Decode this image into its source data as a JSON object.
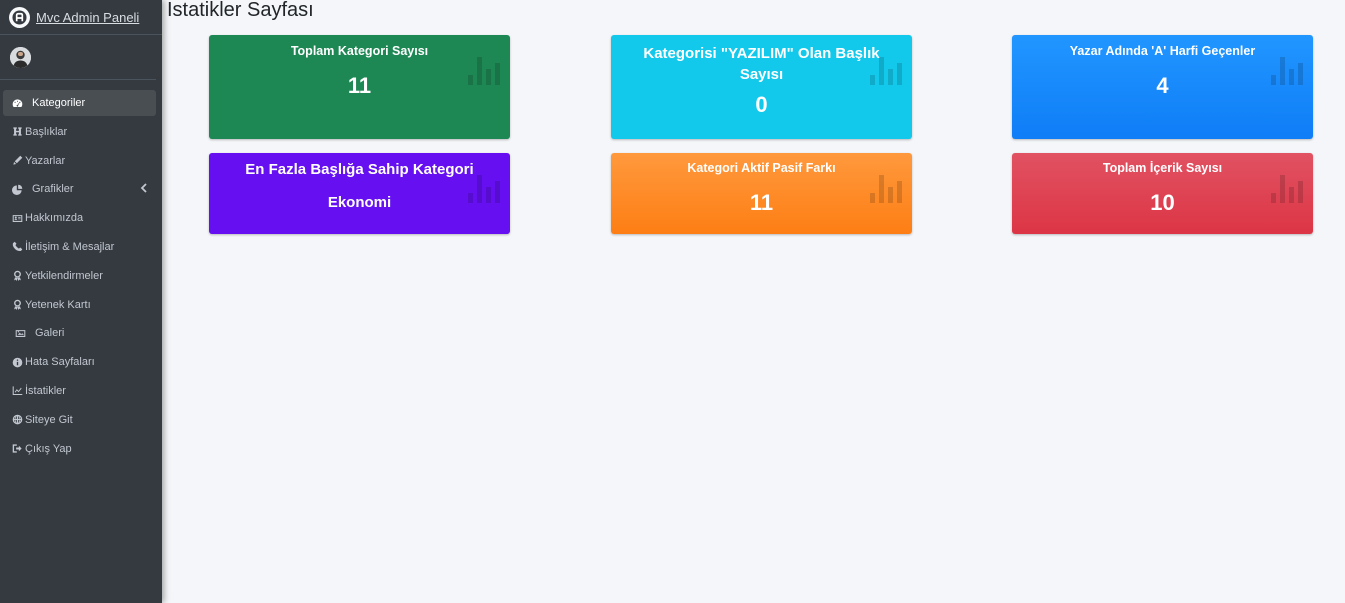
{
  "brand": {
    "name": "Mvc Admin Paneli"
  },
  "page": {
    "title": "İstatikler Sayfası"
  },
  "sidebar": {
    "items": [
      {
        "label": "Kategoriler",
        "icon": "dashboard-icon",
        "active": true
      },
      {
        "label": "Başlıklar",
        "icon": "heading-icon"
      },
      {
        "label": "Yazarlar",
        "icon": "pen-icon"
      },
      {
        "label": "Grafikler",
        "icon": "pie-chart-icon",
        "has_submenu": true
      },
      {
        "label": "Hakkımızda",
        "icon": "id-card-icon"
      },
      {
        "label": "İletişim & Mesajlar",
        "icon": "phone-icon"
      },
      {
        "label": "Yetkilendirmeler",
        "icon": "award-icon"
      },
      {
        "label": "Yetenek Kartı",
        "icon": "award-icon"
      },
      {
        "label": "Galeri",
        "icon": "image-icon"
      },
      {
        "label": "Hata Sayfaları",
        "icon": "info-circle-icon"
      },
      {
        "label": "İstatikler",
        "icon": "line-chart-icon"
      },
      {
        "label": "Siteye Git",
        "icon": "globe-icon"
      },
      {
        "label": "Çıkış Yap",
        "icon": "sign-out-icon"
      }
    ]
  },
  "stats": [
    {
      "title": "Toplam Kategori Sayısı",
      "value": "11",
      "color": "#1e8854"
    },
    {
      "title": "Kategorisi \"YAZILIM\" Olan Başlık Sayısı",
      "value": "0",
      "color": "#12c9ec"
    },
    {
      "title": "Yazar Adında 'A' Harfi Geçenler",
      "value": "4",
      "color": "#0f7df7"
    },
    {
      "title": "En Fazla Başlığa Sahip Kategori",
      "value": "Ekonomi",
      "color": "#6610f2"
    },
    {
      "title": "Kategori Aktif Pasif Farkı",
      "value": "11",
      "color": "#fd7e14"
    },
    {
      "title": "Toplam İçerik Sayısı",
      "value": "10",
      "color": "#dc3545"
    }
  ]
}
